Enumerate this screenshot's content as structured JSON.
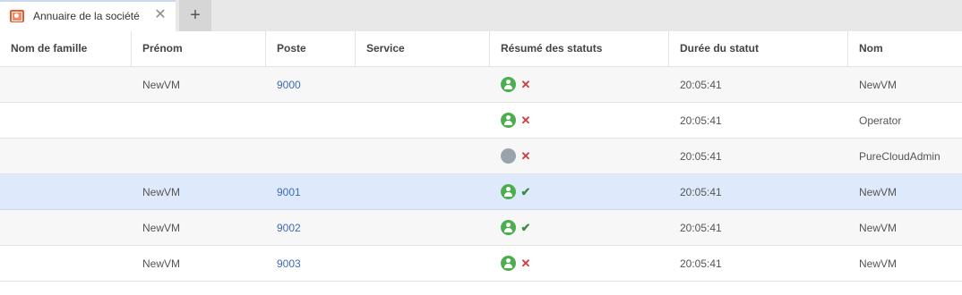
{
  "tabs": {
    "active_label": "Annuaire de la société",
    "close_glyph": "✕",
    "new_tab_glyph": "+"
  },
  "columns": [
    "Nom de famille",
    "Prénom",
    "Poste",
    "Service",
    "Résumé des statuts",
    "Durée du statut",
    "Nom"
  ],
  "rows": [
    {
      "last_name": "",
      "first_name": "NewVM",
      "extension": "9000",
      "department": "",
      "presence": "available",
      "status_flag": "cross",
      "duration": "20:05:41",
      "name": "NewVM"
    },
    {
      "last_name": "",
      "first_name": "",
      "extension": "",
      "department": "",
      "presence": "available",
      "status_flag": "cross",
      "duration": "20:05:41",
      "name": "Operator"
    },
    {
      "last_name": "",
      "first_name": "",
      "extension": "",
      "department": "",
      "presence": "offline",
      "status_flag": "cross",
      "duration": "20:05:41",
      "name": "PureCloudAdmin"
    },
    {
      "last_name": "",
      "first_name": "NewVM",
      "extension": "9001",
      "department": "",
      "presence": "available",
      "status_flag": "check",
      "duration": "20:05:41",
      "name": "NewVM"
    },
    {
      "last_name": "",
      "first_name": "NewVM",
      "extension": "9002",
      "department": "",
      "presence": "available",
      "status_flag": "check",
      "duration": "20:05:41",
      "name": "NewVM"
    },
    {
      "last_name": "",
      "first_name": "NewVM",
      "extension": "9003",
      "department": "",
      "presence": "available",
      "status_flag": "cross",
      "duration": "20:05:41",
      "name": "NewVM"
    }
  ],
  "selected_row": 3,
  "colors": {
    "presence_available": "#4cae4f",
    "presence_offline": "#9aa3ab",
    "flag_cross": "#d23b3b",
    "flag_check": "#3d8a3f",
    "link": "#3c6cb4",
    "selected_row": "#deeafc",
    "tab_icon": "#e85a2c"
  },
  "icons": {
    "tab": "company-directory-icon",
    "available": "person-available-icon",
    "offline": "person-offline-icon",
    "cross": "cross-icon",
    "check": "check-icon"
  }
}
